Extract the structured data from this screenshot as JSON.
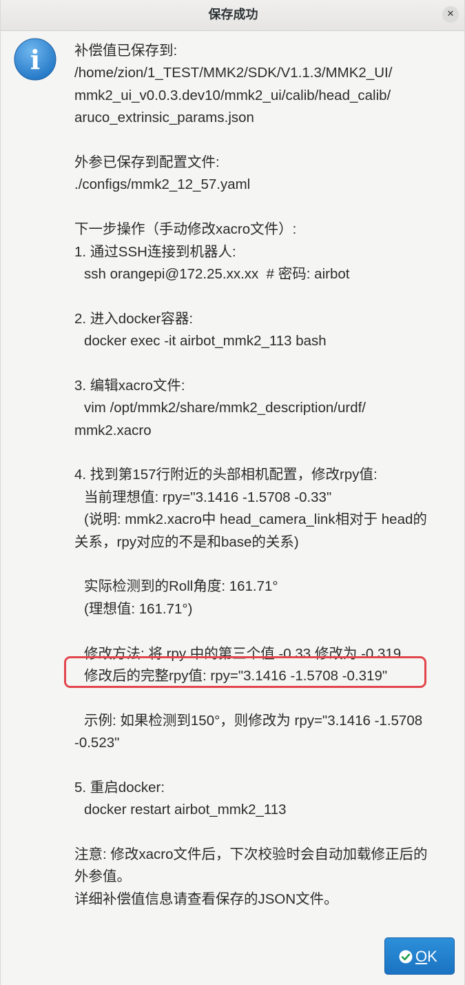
{
  "dialog": {
    "title": "保存成功",
    "close_glyph": "✕",
    "icon": "info-icon",
    "icon_letter": "i",
    "lines": [
      {
        "text": "补偿值已保存到:",
        "indent": false
      },
      {
        "text": "/home/zion/1_TEST/MMK2/SDK/V1.1.3/MMK2_UI/",
        "indent": false
      },
      {
        "text": "mmk2_ui_v0.0.3.dev10/mmk2_ui/calib/head_calib/",
        "indent": false
      },
      {
        "text": "aruco_extrinsic_params.json",
        "indent": false
      },
      {
        "text": "",
        "indent": false
      },
      {
        "text": "外参已保存到配置文件:",
        "indent": false
      },
      {
        "text": "./configs/mmk2_12_57.yaml",
        "indent": false
      },
      {
        "text": "",
        "indent": false
      },
      {
        "text": "下一步操作（手动修改xacro文件）:",
        "indent": false
      },
      {
        "text": "1. 通过SSH连接到机器人:",
        "indent": false
      },
      {
        "text": "ssh orangepi@172.25.xx.xx  # 密码: airbot",
        "indent": true
      },
      {
        "text": "",
        "indent": false
      },
      {
        "text": "2. 进入docker容器:",
        "indent": false
      },
      {
        "text": "docker exec -it airbot_mmk2_113 bash",
        "indent": true
      },
      {
        "text": "",
        "indent": false
      },
      {
        "text": "3. 编辑xacro文件:",
        "indent": false
      },
      {
        "text": "vim /opt/mmk2/share/mmk2_description/urdf/",
        "indent": true
      },
      {
        "text": "mmk2.xacro",
        "indent": false
      },
      {
        "text": "",
        "indent": false
      },
      {
        "text": "4. 找到第157行附近的头部相机配置，修改rpy值:",
        "indent": false
      },
      {
        "text": "当前理想值: rpy=\"3.1416 -1.5708 -0.33\"",
        "indent": true
      },
      {
        "text": "(说明: mmk2.xacro中 head_camera_link相对于 head的",
        "indent": true
      },
      {
        "text": "关系，rpy对应的不是和base的关系)",
        "indent": false
      },
      {
        "text": "",
        "indent": false
      },
      {
        "text": "实际检测到的Roll角度: 161.71°",
        "indent": true
      },
      {
        "text": "(理想值: 161.71°)",
        "indent": true
      },
      {
        "text": "",
        "indent": false
      },
      {
        "text": "修改方法: 将 rpy 中的第三个值 -0.33 修改为 -0.319",
        "indent": true
      },
      {
        "text": "修改后的完整rpy值: rpy=\"3.1416 -1.5708 -0.319\"",
        "indent": true
      },
      {
        "text": "",
        "indent": false
      },
      {
        "text": "示例: 如果检测到150°，则修改为 rpy=\"3.1416 -1.5708",
        "indent": true
      },
      {
        "text": "-0.523\"",
        "indent": false
      },
      {
        "text": "",
        "indent": false
      },
      {
        "text": "5. 重启docker:",
        "indent": false
      },
      {
        "text": "docker restart airbot_mmk2_113",
        "indent": true
      },
      {
        "text": "",
        "indent": false
      },
      {
        "text": "注意: 修改xacro文件后，下次校验时会自动加载修正后的",
        "indent": false
      },
      {
        "text": "外参值。",
        "indent": false
      },
      {
        "text": "详细补偿值信息请查看保存的JSON文件。",
        "indent": false
      }
    ],
    "ok_button": {
      "mnemonic": "O",
      "rest": "K",
      "icon": "check-icon"
    }
  },
  "colors": {
    "accent": "#1a73c2",
    "highlight": "#e2454a",
    "info_icon": "#2f8ad8",
    "check": "#1e9e4a"
  }
}
